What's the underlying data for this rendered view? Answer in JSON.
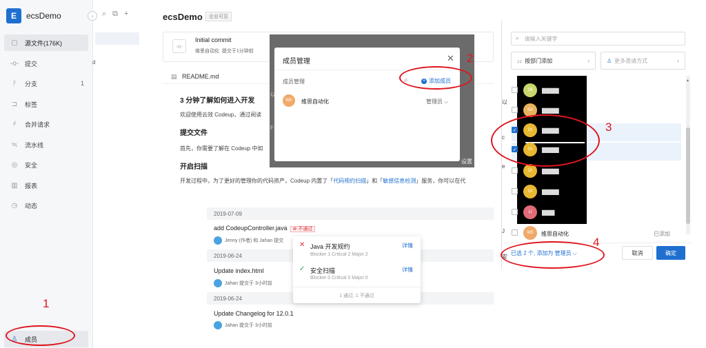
{
  "sidebar": {
    "logo": "E",
    "project": "ecsDemo",
    "collapse": "‹",
    "items": [
      {
        "label": "源文件(176K)",
        "icon": "code-icon",
        "glyph": "▢"
      },
      {
        "label": "提交",
        "icon": "commit-icon",
        "glyph": "-o-"
      },
      {
        "label": "分支",
        "icon": "branch-icon",
        "glyph": "ᚹ",
        "count": "1"
      },
      {
        "label": "标签",
        "icon": "tag-icon",
        "glyph": "⊐"
      },
      {
        "label": "合并请求",
        "icon": "merge-icon",
        "glyph": "⫩"
      },
      {
        "label": "流水线",
        "icon": "pipeline-icon",
        "glyph": "≒"
      },
      {
        "label": "安全",
        "icon": "shield-icon",
        "glyph": "◎"
      },
      {
        "label": "报表",
        "icon": "chart-icon",
        "glyph": "▥"
      },
      {
        "label": "动态",
        "icon": "activity-icon",
        "glyph": "◷"
      }
    ],
    "members": {
      "label": "成员",
      "glyph": "♙"
    }
  },
  "tools": {
    "search": "⌕",
    "copy": "⧉",
    "add": "+"
  },
  "sub_nav_letter": "d",
  "repo": {
    "title": "ecsDemo",
    "badge": "企业可见"
  },
  "commit": {
    "icon": "-o-",
    "title": "Initial commit",
    "author": "维思自动化",
    "time": "提交于1分钟前"
  },
  "readme": {
    "icon": "▤",
    "name": "README.md"
  },
  "doc": {
    "h1": "3 分钟了解如何进入开发",
    "p1": "欢迎使用云效 Codeup，通过阅读",
    "h2": "提交文件",
    "p2": "首先，你需要了解在 Codeup 中如",
    "h3": "开启扫描",
    "p3a": "开发过程中，为了更好的管理你的代码资产，Codeup 内置了「",
    "p3link1": "代码规约扫描",
    "p3b": "」和「",
    "p3link2": "敏感信息检测",
    "p3c": "」服务，你可以在代"
  },
  "history": [
    {
      "date": "2019-07-09",
      "title": "add CodeupController.java",
      "badge": "⊗ 不通过",
      "meta": "Jenny (作者) 和 Jahan  提交"
    },
    {
      "date": "2019-06-24",
      "title": "Update index.html",
      "meta": "Jahan  提交于 3小时前"
    },
    {
      "date": "2019-06-24",
      "title": "Update Changelog for 12.0.1",
      "meta": "Jahan  提交于 3小时前"
    }
  ],
  "popover": {
    "r1_title": "Java 开发规约",
    "r1_sub": "Blocker 1 Critical 2 Major 2",
    "r1_link": "详情",
    "r1_mark": "✕",
    "r2_title": "安全扫描",
    "r2_sub": "Blocker 0 Critical 0 Major 0",
    "r2_link": "详情",
    "r2_mark": "✓",
    "footer": "1 通过, 1 不通过"
  },
  "modal": {
    "title": "成员管理",
    "close": "✕",
    "label": "成员管理",
    "search": "⌕",
    "add": "添加成员",
    "add_glyph": "+",
    "member_avatar": "WE",
    "member_name": "维思自动化",
    "member_role": "管理员 ⌵",
    "behind_1": "以",
    "behind_2": "F",
    "behind_3": "设置 -"
  },
  "picker": {
    "search_placeholder": "请输入关键字",
    "search_icon": "⌕",
    "by_dept": "按部门添加",
    "by_dept_icon": "⚏",
    "more_invite": "更多邀请方式",
    "more_invite_icon": "♙",
    "chev": "›",
    "rows": [
      {
        "initials": "1B",
        "color": "#c9d66b",
        "name": "▇▇▇▇",
        "checked": false
      },
      {
        "initials": "SX",
        "color": "#e8b25c",
        "name": "▇▇▇▇",
        "checked": false
      },
      {
        "initials": "DI",
        "color": "#e8b830",
        "name": "▇▇▇▇",
        "checked": true
      },
      {
        "initials": "DI",
        "color": "#e8b830",
        "name": "▇▇▇▇",
        "checked": true
      },
      {
        "initials": "DI",
        "color": "#e8b830",
        "name": "▇▇▇▇",
        "checked": false
      },
      {
        "initials": "DI",
        "color": "#e8b830",
        "name": "▇▇▇▇",
        "checked": false
      },
      {
        "initials": "LI",
        "color": "#e06b78",
        "name": "▇▇▇",
        "checked": false
      }
    ],
    "check": "✓",
    "last_avatar": "WE",
    "last_name": "维思自动化",
    "last_status": "已添加",
    "selected_text": "已选 2 个, 添加为",
    "selected_role": "管理员 ⌵",
    "cancel": "取消",
    "ok": "确定",
    "scroll_up": "▴",
    "side_letters": [
      "以",
      "c",
      "e",
      "J",
      "安"
    ]
  },
  "annotations": [
    "1",
    "2",
    "3",
    "4"
  ]
}
